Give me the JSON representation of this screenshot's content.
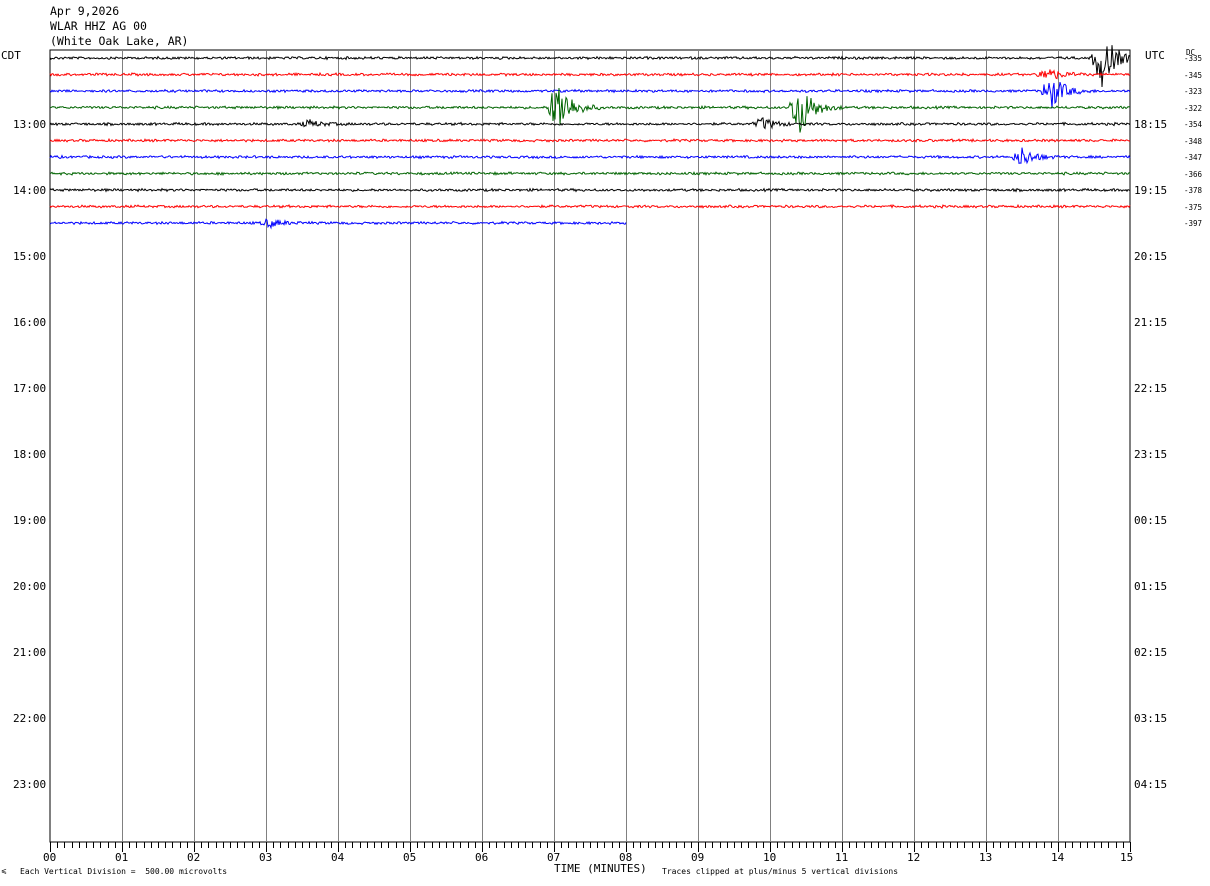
{
  "header": {
    "date": "Apr 9,2026",
    "station": "WLAR HHZ AG 00",
    "location": "(White Oak Lake, AR)",
    "left_zone": "CDT",
    "right_zone": "UTC",
    "dc_label": "DC"
  },
  "footer": {
    "division_note": "Each Vertical Division =  500.00 microvolts",
    "axis_title": "TIME (MINUTES)",
    "clip_note": "Traces clipped at plus/minus 5 vertical divisions",
    "corner_mark": "⩽"
  },
  "chart_data": {
    "type": "line",
    "title": "",
    "xlabel": "TIME (MINUTES)",
    "ylabel": "",
    "xlim": [
      0,
      15
    ],
    "x_ticks": [
      "00",
      "01",
      "02",
      "03",
      "04",
      "05",
      "06",
      "07",
      "08",
      "09",
      "10",
      "11",
      "12",
      "13",
      "14",
      "15"
    ],
    "grid": true,
    "left_hour_labels": [
      "13:00",
      "14:00",
      "15:00",
      "16:00",
      "17:00",
      "18:00",
      "19:00",
      "20:00",
      "21:00",
      "22:00",
      "23:00"
    ],
    "right_hour_labels": [
      "18:15",
      "19:15",
      "20:15",
      "21:15",
      "22:15",
      "23:15",
      "00:15",
      "01:15",
      "02:15",
      "03:15",
      "04:15"
    ],
    "trace_colors": [
      "#000000",
      "#ff0000",
      "#0000ff",
      "#006400"
    ],
    "dc_offsets": [
      "-335",
      "-345",
      "-323",
      "-322",
      "-354",
      "-348",
      "-347",
      "-366",
      "-378",
      "-375",
      "-397"
    ],
    "traces": [
      {
        "row": 0,
        "color": "#000000",
        "dc": "-335",
        "end_minute": 15,
        "events": [
          {
            "minute": 14.6,
            "amplitude": 5
          }
        ]
      },
      {
        "row": 1,
        "color": "#ff0000",
        "dc": "-345",
        "end_minute": 15,
        "events": [
          {
            "minute": 13.85,
            "amplitude": 1.2
          }
        ]
      },
      {
        "row": 2,
        "color": "#0000ff",
        "dc": "-323",
        "end_minute": 15,
        "events": [
          {
            "minute": 13.9,
            "amplitude": 3
          }
        ]
      },
      {
        "row": 3,
        "color": "#006400",
        "dc": "-322",
        "end_minute": 15,
        "events": [
          {
            "minute": 7.05,
            "amplitude": 5
          },
          {
            "minute": 10.4,
            "amplitude": 5
          }
        ]
      },
      {
        "row": 4,
        "color": "#000000",
        "dc": "-354",
        "end_minute": 15,
        "events": [
          {
            "minute": 9.9,
            "amplitude": 1
          },
          {
            "minute": 3.6,
            "amplitude": 0.6
          }
        ]
      },
      {
        "row": 5,
        "color": "#ff0000",
        "dc": "-348",
        "end_minute": 15,
        "events": []
      },
      {
        "row": 6,
        "color": "#0000ff",
        "dc": "-347",
        "end_minute": 15,
        "events": [
          {
            "minute": 13.5,
            "amplitude": 1.6
          }
        ]
      },
      {
        "row": 7,
        "color": "#006400",
        "dc": "-366",
        "end_minute": 15,
        "events": []
      },
      {
        "row": 8,
        "color": "#000000",
        "dc": "-378",
        "end_minute": 15,
        "events": []
      },
      {
        "row": 9,
        "color": "#ff0000",
        "dc": "-375",
        "end_minute": 15,
        "events": []
      },
      {
        "row": 10,
        "color": "#0000ff",
        "dc": "-397",
        "end_minute": 8,
        "events": [
          {
            "minute": 3.05,
            "amplitude": 0.7
          }
        ]
      }
    ]
  }
}
